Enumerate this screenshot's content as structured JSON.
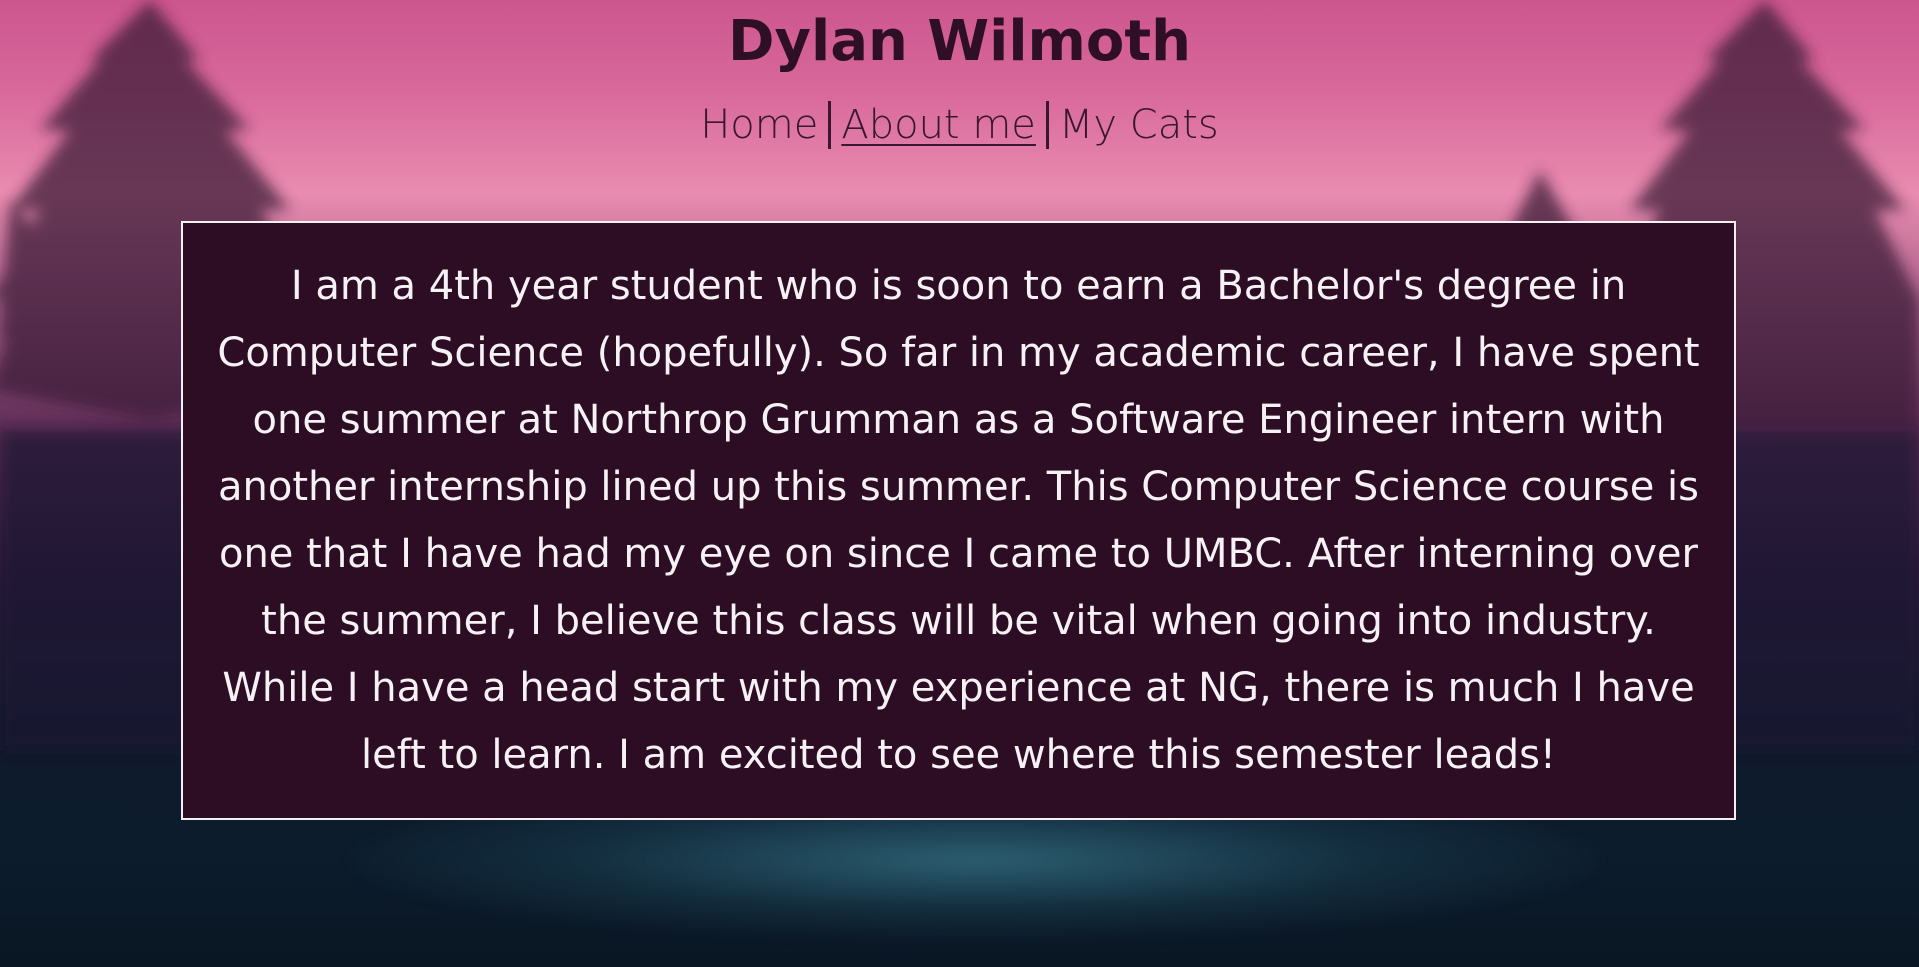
{
  "site": {
    "title": "Dylan Wilmoth"
  },
  "nav": {
    "items": [
      {
        "label": "Home",
        "active": false
      },
      {
        "label": "About me",
        "active": true
      },
      {
        "label": "My Cats",
        "active": false
      }
    ]
  },
  "main": {
    "about_text": "I am a 4th year student who is soon to earn a Bachelor's degree in Computer Science (hopefully). So far in my academic career, I have spent one summer at Northrop Grumman as a Software Engineer intern with another internship lined up this summer. This Computer Science course is one that I have had my eye on since I came to UMBC. After interning over the summer, I believe this class will be vital when going into industry. While I have a head start with my experience at NG, there is much I have left to learn. I am excited to see where this semester leads!"
  },
  "colors": {
    "title_text": "#2e0f26",
    "nav_text": "#3a1730",
    "panel_background": "#2c0d24",
    "panel_border": "#f4f0f2",
    "panel_text": "#f6f1f4"
  }
}
